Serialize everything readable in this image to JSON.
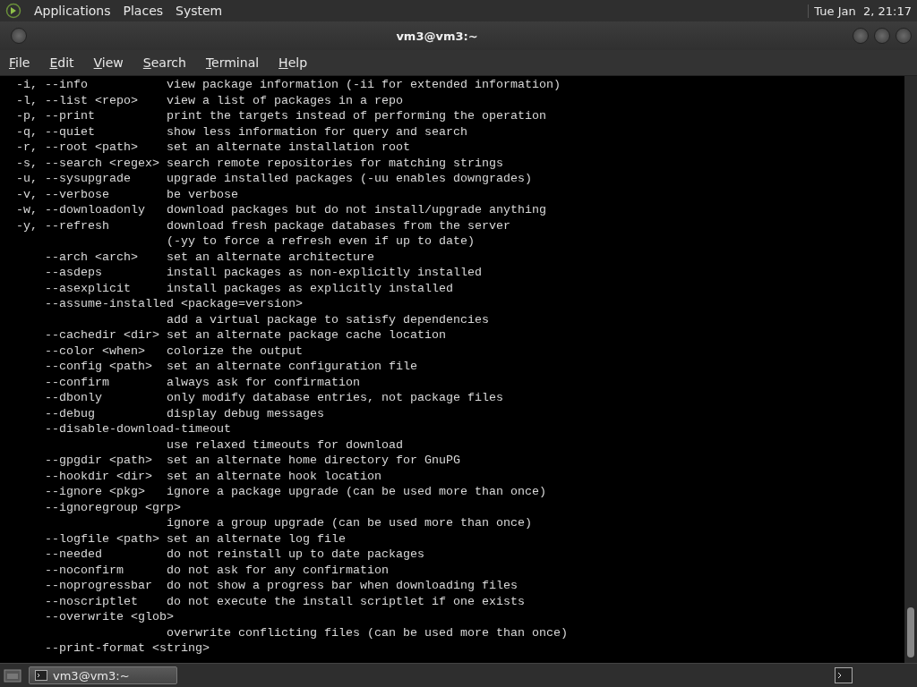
{
  "top_panel": {
    "menus": [
      "Applications",
      "Places",
      "System"
    ],
    "clock": "Tue Jan  2, 21:17"
  },
  "window": {
    "title": "vm3@vm3:~"
  },
  "menubar": [
    {
      "label": "File"
    },
    {
      "label": "Edit"
    },
    {
      "label": "View"
    },
    {
      "label": "Search"
    },
    {
      "label": "Terminal"
    },
    {
      "label": "Help"
    }
  ],
  "terminal": {
    "lines": [
      {
        "option": "-i, --info",
        "description": "view package information (-ii for extended information)"
      },
      {
        "option": "-l, --list <repo>",
        "description": "view a list of packages in a repo"
      },
      {
        "option": "-p, --print",
        "description": "print the targets instead of performing the operation"
      },
      {
        "option": "-q, --quiet",
        "description": "show less information for query and search"
      },
      {
        "option": "-r, --root <path>",
        "description": "set an alternate installation root"
      },
      {
        "option": "-s, --search <regex>",
        "description": "search remote repositories for matching strings"
      },
      {
        "option": "-u, --sysupgrade",
        "description": "upgrade installed packages (-uu enables downgrades)"
      },
      {
        "option": "-v, --verbose",
        "description": "be verbose"
      },
      {
        "option": "-w, --downloadonly",
        "description": "download packages but do not install/upgrade anything"
      },
      {
        "option": "-y, --refresh",
        "description": "download fresh package databases from the server"
      },
      {
        "description": "(-yy to force a refresh even if up to date)"
      },
      {
        "option": "    --arch <arch>",
        "description": "set an alternate architecture"
      },
      {
        "option": "    --asdeps",
        "description": "install packages as non-explicitly installed"
      },
      {
        "option": "    --asexplicit",
        "description": "install packages as explicitly installed"
      },
      {
        "option": "    --assume-installed <package=version>"
      },
      {
        "description": "add a virtual package to satisfy dependencies"
      },
      {
        "option": "    --cachedir <dir>",
        "description": "set an alternate package cache location"
      },
      {
        "option": "    --color <when>",
        "description": "colorize the output"
      },
      {
        "option": "    --config <path>",
        "description": "set an alternate configuration file"
      },
      {
        "option": "    --confirm",
        "description": "always ask for confirmation"
      },
      {
        "option": "    --dbonly",
        "description": "only modify database entries, not package files"
      },
      {
        "option": "    --debug",
        "description": "display debug messages"
      },
      {
        "option": "    --disable-download-timeout"
      },
      {
        "description": "use relaxed timeouts for download"
      },
      {
        "option": "    --gpgdir <path>",
        "description": "set an alternate home directory for GnuPG"
      },
      {
        "option": "    --hookdir <dir>",
        "description": "set an alternate hook location"
      },
      {
        "option": "    --ignore <pkg>",
        "description": "ignore a package upgrade (can be used more than once)"
      },
      {
        "option": "    --ignoregroup <grp>"
      },
      {
        "description": "ignore a group upgrade (can be used more than once)"
      },
      {
        "option": "    --logfile <path>",
        "description": "set an alternate log file"
      },
      {
        "option": "    --needed",
        "description": "do not reinstall up to date packages"
      },
      {
        "option": "    --noconfirm",
        "description": "do not ask for any confirmation"
      },
      {
        "option": "    --noprogressbar",
        "description": "do not show a progress bar when downloading files"
      },
      {
        "option": "    --noscriptlet",
        "description": "do not execute the install scriptlet if one exists"
      },
      {
        "option": "    --overwrite <glob>"
      },
      {
        "description": "overwrite conflicting files (can be used more than once)"
      },
      {
        "option": "    --print-format <string>"
      }
    ]
  },
  "taskbar": {
    "tasks": [
      {
        "label": "vm3@vm3:~",
        "selected": true
      }
    ]
  }
}
